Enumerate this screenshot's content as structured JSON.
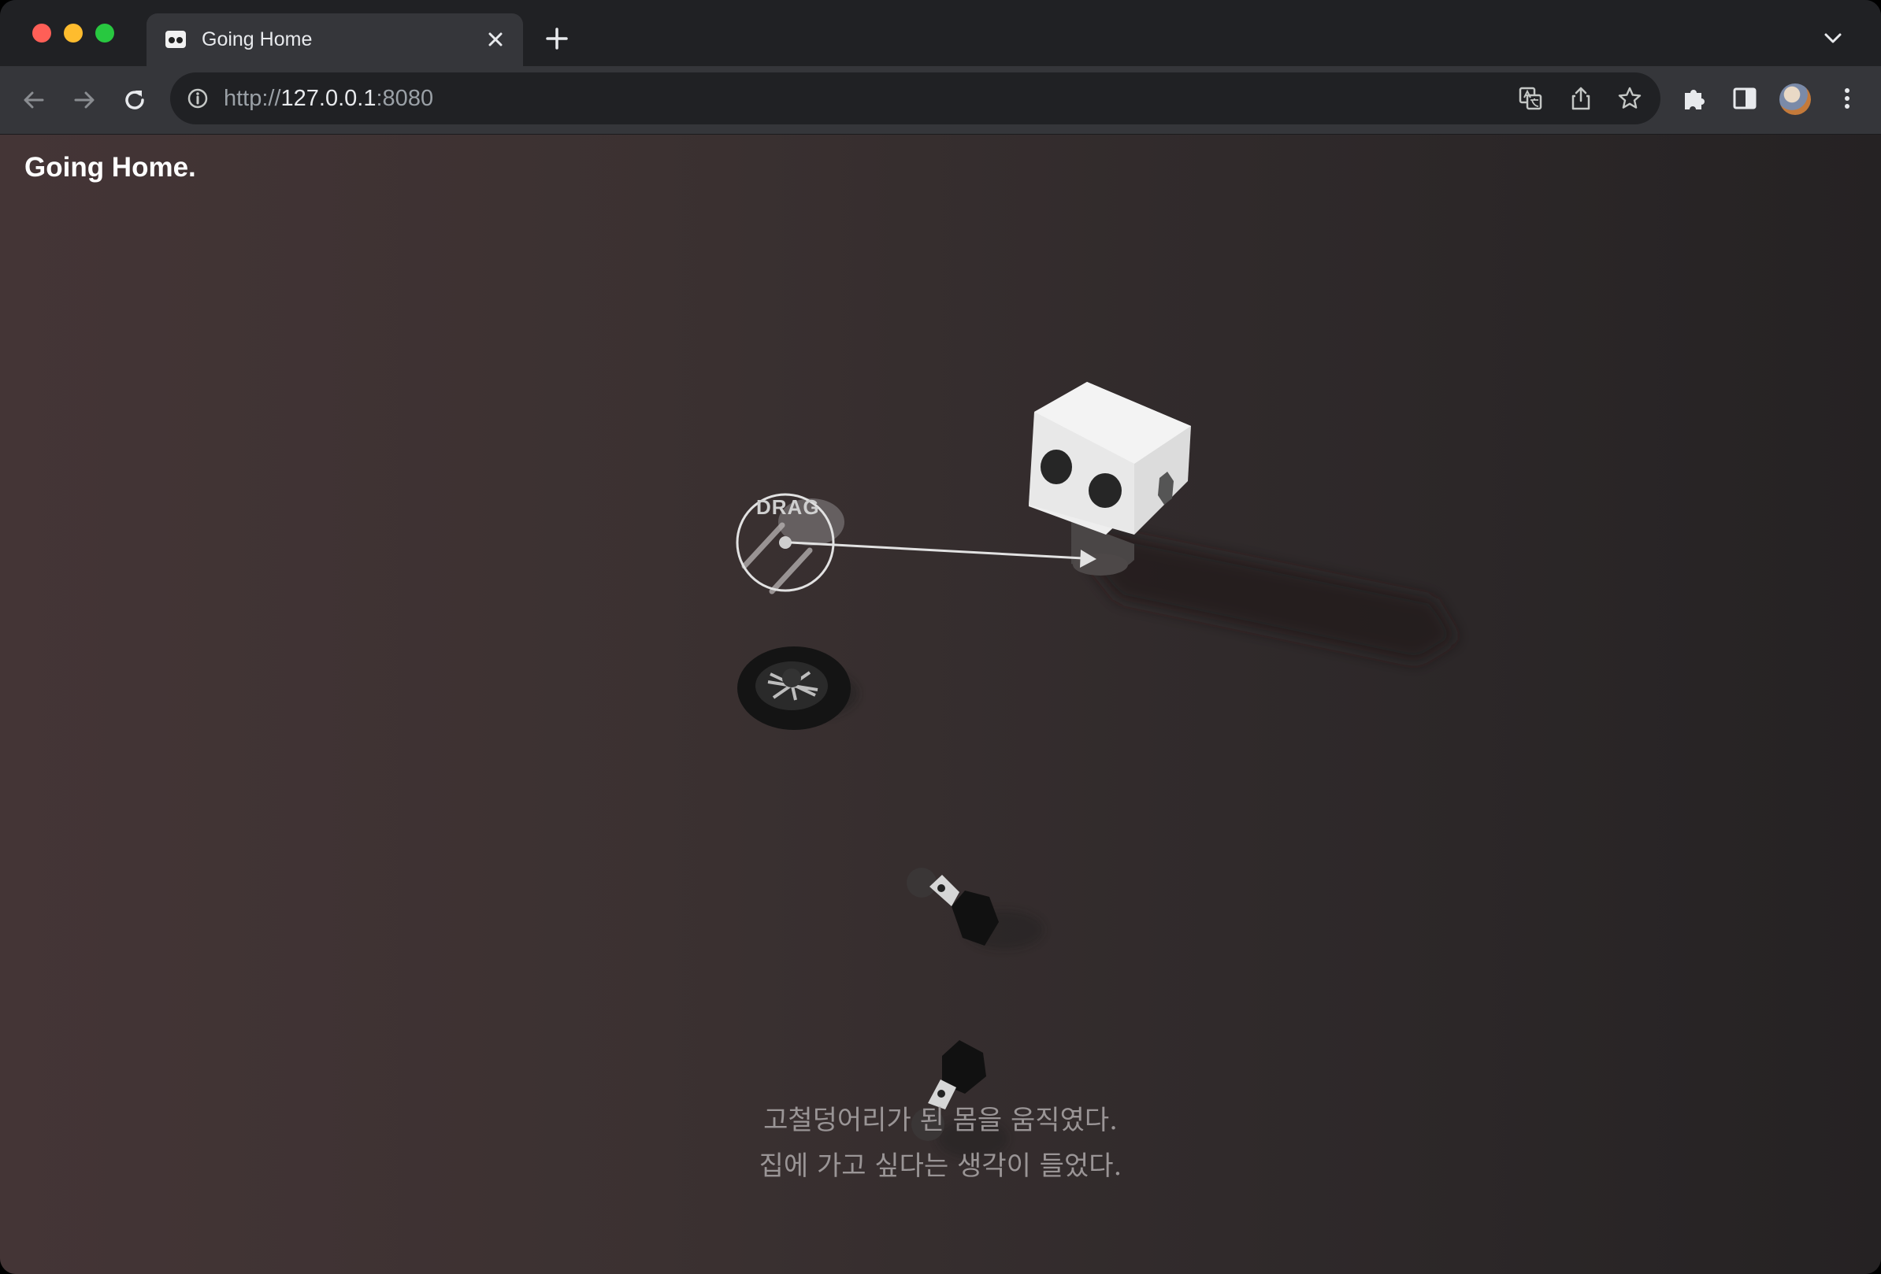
{
  "browser": {
    "tab": {
      "title": "Going Home",
      "icon": "robot-face-favicon-icon"
    },
    "url": {
      "scheme": "http://",
      "host": "127.0.0.1",
      "port": ":8080"
    },
    "icons": [
      "back-arrow-icon",
      "forward-arrow-icon",
      "reload-icon",
      "site-info-icon",
      "translate-icon",
      "share-icon",
      "bookmark-star-icon",
      "extensions-puzzle-icon",
      "side-panel-icon",
      "profile-avatar",
      "more-menu-icon",
      "new-tab-plus-icon",
      "tab-close-icon",
      "tab-search-chevron-icon"
    ]
  },
  "page": {
    "title": "Going Home.",
    "drag_label": "DRAG",
    "caption": [
      "고철덩어리가 된 몸을 움직였다.",
      "집에 가고 싶다는 생각이 들었다."
    ]
  },
  "colors": {
    "page_bg_left": "#443536",
    "page_bg_right": "#252223",
    "robot_head": "#eeeeee",
    "robot_eyes": "#222222"
  }
}
